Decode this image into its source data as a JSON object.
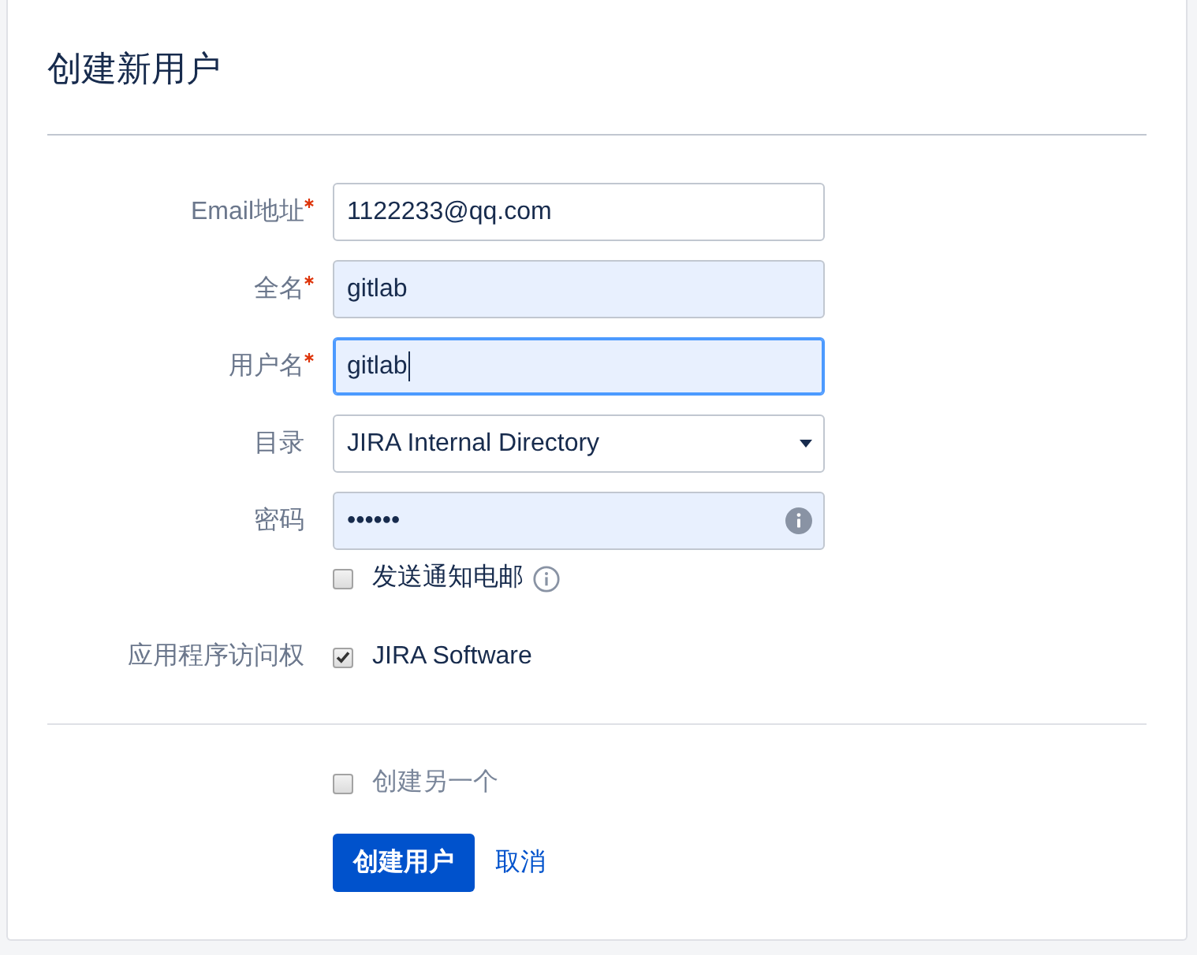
{
  "title": "创建新用户",
  "fields": [
    {
      "kind": "email",
      "label": "Email地址",
      "required": true,
      "value": "1122233@qq.com",
      "autofilled": false,
      "focused": false
    },
    {
      "kind": "text",
      "label": "全名",
      "required": true,
      "value": "gitlab",
      "autofilled": true,
      "focused": false
    },
    {
      "kind": "text",
      "label": "用户名",
      "required": true,
      "value": "gitlab",
      "autofilled": true,
      "focused": true
    },
    {
      "kind": "select",
      "label": "目录",
      "required": false,
      "value": "JIRA Internal Directory",
      "autofilled": false,
      "focused": false
    },
    {
      "kind": "password",
      "label": "密码",
      "required": false,
      "value": "••••••",
      "autofilled": true,
      "focused": false
    }
  ],
  "notify": {
    "label": "发送通知电邮",
    "checked": false
  },
  "app_access": {
    "label": "应用程序访问权",
    "options": [
      {
        "label": "JIRA Software",
        "checked": true
      }
    ]
  },
  "create_another": {
    "label": "创建另一个",
    "checked": false
  },
  "actions": {
    "submit": "创建用户",
    "cancel": "取消"
  }
}
